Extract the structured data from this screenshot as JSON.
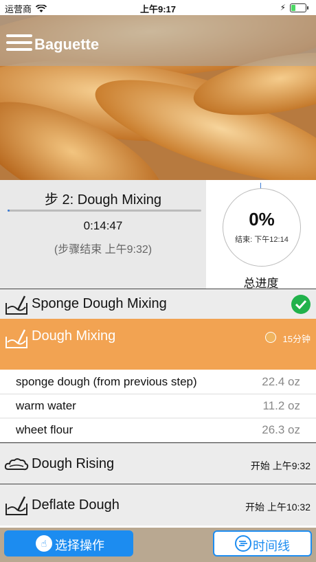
{
  "status_bar": {
    "carrier": "运营商",
    "time": "上午9:17",
    "battery_level": 0.35,
    "battery_color": "#4cd964"
  },
  "header": {
    "title": "Baguette",
    "menu_icon": "hamburger-icon"
  },
  "current_step": {
    "title": "步 2: Dough Mixing",
    "progress": 0.01,
    "timer": "0:14:47",
    "end_text": "(步骤结束 上午9:32)"
  },
  "total": {
    "percent": "0%",
    "end_text": "结束: 下午12:14",
    "label": "总进度"
  },
  "steps": [
    {
      "title": "Sponge Dough Mixing",
      "icon": "mixing-bowl-icon",
      "status": "completed"
    },
    {
      "title": "Dough Mixing",
      "icon": "mixing-bowl-icon",
      "duration": "15分钟",
      "status": "active",
      "ingredients": [
        {
          "name": "sponge dough (from previous step)",
          "qty": "22.4 oz"
        },
        {
          "name": "warm water",
          "qty": "11.2 oz"
        },
        {
          "name": "wheet flour",
          "qty": "26.3 oz"
        }
      ]
    },
    {
      "title": "Dough Rising",
      "icon": "cloud-icon",
      "start": "开始 上午9:32"
    },
    {
      "title": "Deflate Dough",
      "icon": "mixing-bowl-icon",
      "start": "开始 上午10:32"
    }
  ],
  "footer": {
    "action_label": "选择操作",
    "timeline_label": "时间线"
  },
  "colors": {
    "accent": "#1c8cf0",
    "active_step": "#f2a352",
    "done": "#21b24b"
  }
}
